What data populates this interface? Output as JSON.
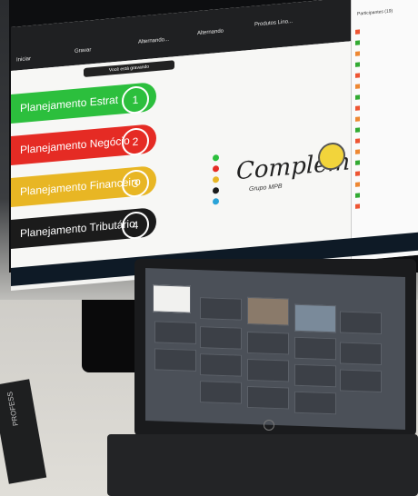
{
  "toolbar": {
    "items": [
      "Gravar",
      "Alternando...",
      "Alternando",
      "Produtos Lino..."
    ],
    "left": "Iniciar",
    "participants_title": "Participantes (19)",
    "recording_notice": "Você está gravando"
  },
  "slide": {
    "pills": [
      {
        "label": "Planejamento Estrat",
        "num": "1",
        "color": "#2cbf3d"
      },
      {
        "label": "Planejamento Negócio",
        "num": "2",
        "color": "#e52b24"
      },
      {
        "label": "Planejamento Financeiro",
        "num": "3",
        "color": "#e8b624"
      },
      {
        "label": "Planejamento Tributário",
        "num": "4",
        "color": "#1b1b1b"
      }
    ],
    "dots": [
      "#2cbf3d",
      "#e52b24",
      "#e8b624",
      "#1b1b1b",
      "#2aa3d8"
    ],
    "logo": "Complem",
    "logo_sub": "Grupo MPB"
  },
  "participants": [
    "",
    "",
    "",
    "",
    "",
    "",
    "",
    "",
    "",
    "",
    "",
    "",
    "",
    "",
    "",
    "",
    "",
    "",
    "",
    ""
  ],
  "laptop": {
    "tiles": [
      "",
      "",
      "",
      "",
      "",
      "",
      "",
      "",
      "",
      "",
      "",
      "",
      "",
      "",
      "",
      "",
      "",
      "",
      "",
      ""
    ]
  },
  "book_label": "PROFESS"
}
